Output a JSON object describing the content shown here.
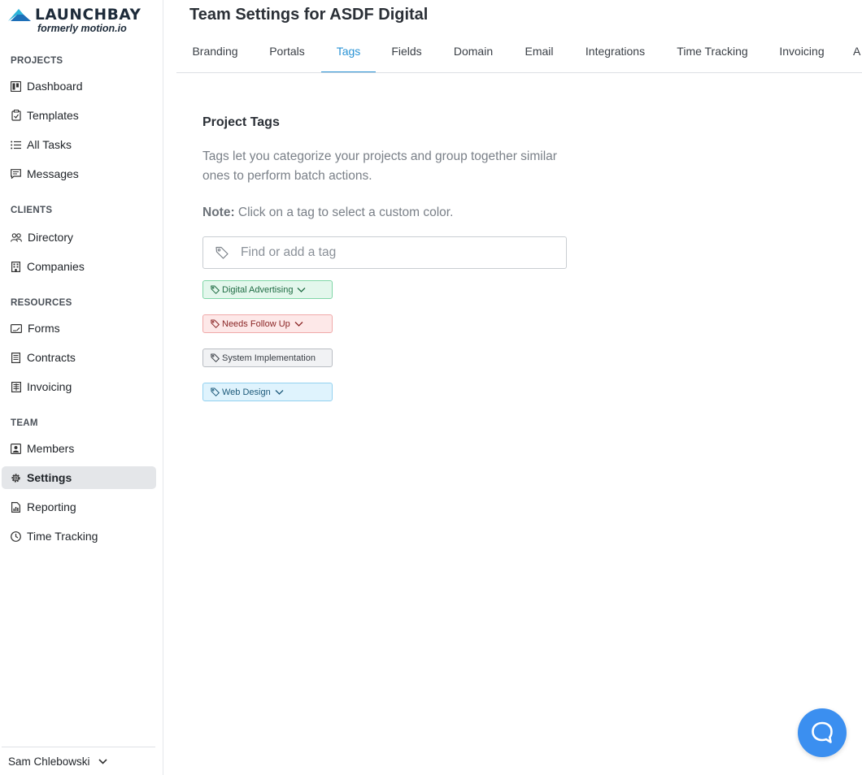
{
  "app": {
    "brand_name": "LAUNCHBAY",
    "brand_tagline": "formerly motion.io"
  },
  "sidebar": {
    "sections": [
      {
        "label": "PROJECTS",
        "items": [
          {
            "label": "Dashboard",
            "icon": "dashboard-icon"
          },
          {
            "label": "Templates",
            "icon": "clipboard-icon"
          },
          {
            "label": "All Tasks",
            "icon": "list-icon"
          },
          {
            "label": "Messages",
            "icon": "message-icon"
          }
        ]
      },
      {
        "label": "CLIENTS",
        "items": [
          {
            "label": "Directory",
            "icon": "people-icon"
          },
          {
            "label": "Companies",
            "icon": "building-icon"
          }
        ]
      },
      {
        "label": "RESOURCES",
        "items": [
          {
            "label": "Forms",
            "icon": "form-icon"
          },
          {
            "label": "Contracts",
            "icon": "document-icon"
          },
          {
            "label": "Invoicing",
            "icon": "invoice-icon"
          }
        ]
      },
      {
        "label": "TEAM",
        "items": [
          {
            "label": "Members",
            "icon": "member-icon"
          },
          {
            "label": "Settings",
            "icon": "gear-icon",
            "active": true
          },
          {
            "label": "Reporting",
            "icon": "report-icon"
          },
          {
            "label": "Time Tracking",
            "icon": "clock-icon"
          }
        ]
      }
    ],
    "user": {
      "name": "Sam Chlebowski"
    }
  },
  "header": {
    "title": "Team Settings for ASDF Digital",
    "tabs": [
      {
        "label": "Branding"
      },
      {
        "label": "Portals"
      },
      {
        "label": "Tags",
        "active": true
      },
      {
        "label": "Fields"
      },
      {
        "label": "Domain"
      },
      {
        "label": "Email"
      },
      {
        "label": "Integrations"
      },
      {
        "label": "Time Tracking"
      },
      {
        "label": "Invoicing"
      },
      {
        "label": "A"
      }
    ]
  },
  "content": {
    "section_title": "Project Tags",
    "description": "Tags let you categorize your projects and group together similar ones to perform batch actions.",
    "note_label": "Note:",
    "note_text": " Click on a tag to select a custom color.",
    "search_placeholder": "Find or add a tag",
    "tags": [
      {
        "label": "Digital Advertising",
        "bg": "#e3f7ec",
        "border": "#7fd6a6",
        "text": "#1f6b43",
        "caret": true
      },
      {
        "label": "Needs Follow Up",
        "bg": "#fde8e8",
        "border": "#f0a9a9",
        "text": "#8a2525",
        "caret": true
      },
      {
        "label": "System Implementation",
        "bg": "#f1f2f4",
        "border": "#b9bdc3",
        "text": "#3a3f46",
        "caret": false
      },
      {
        "label": "Web Design",
        "bg": "#dff3fd",
        "border": "#93d1f0",
        "text": "#1d5a7a",
        "caret": true
      }
    ]
  },
  "colors": {
    "accent": "#2a93d5",
    "help_bubble": "#3b8ff0",
    "logo_accent": "#2bb3d9"
  }
}
